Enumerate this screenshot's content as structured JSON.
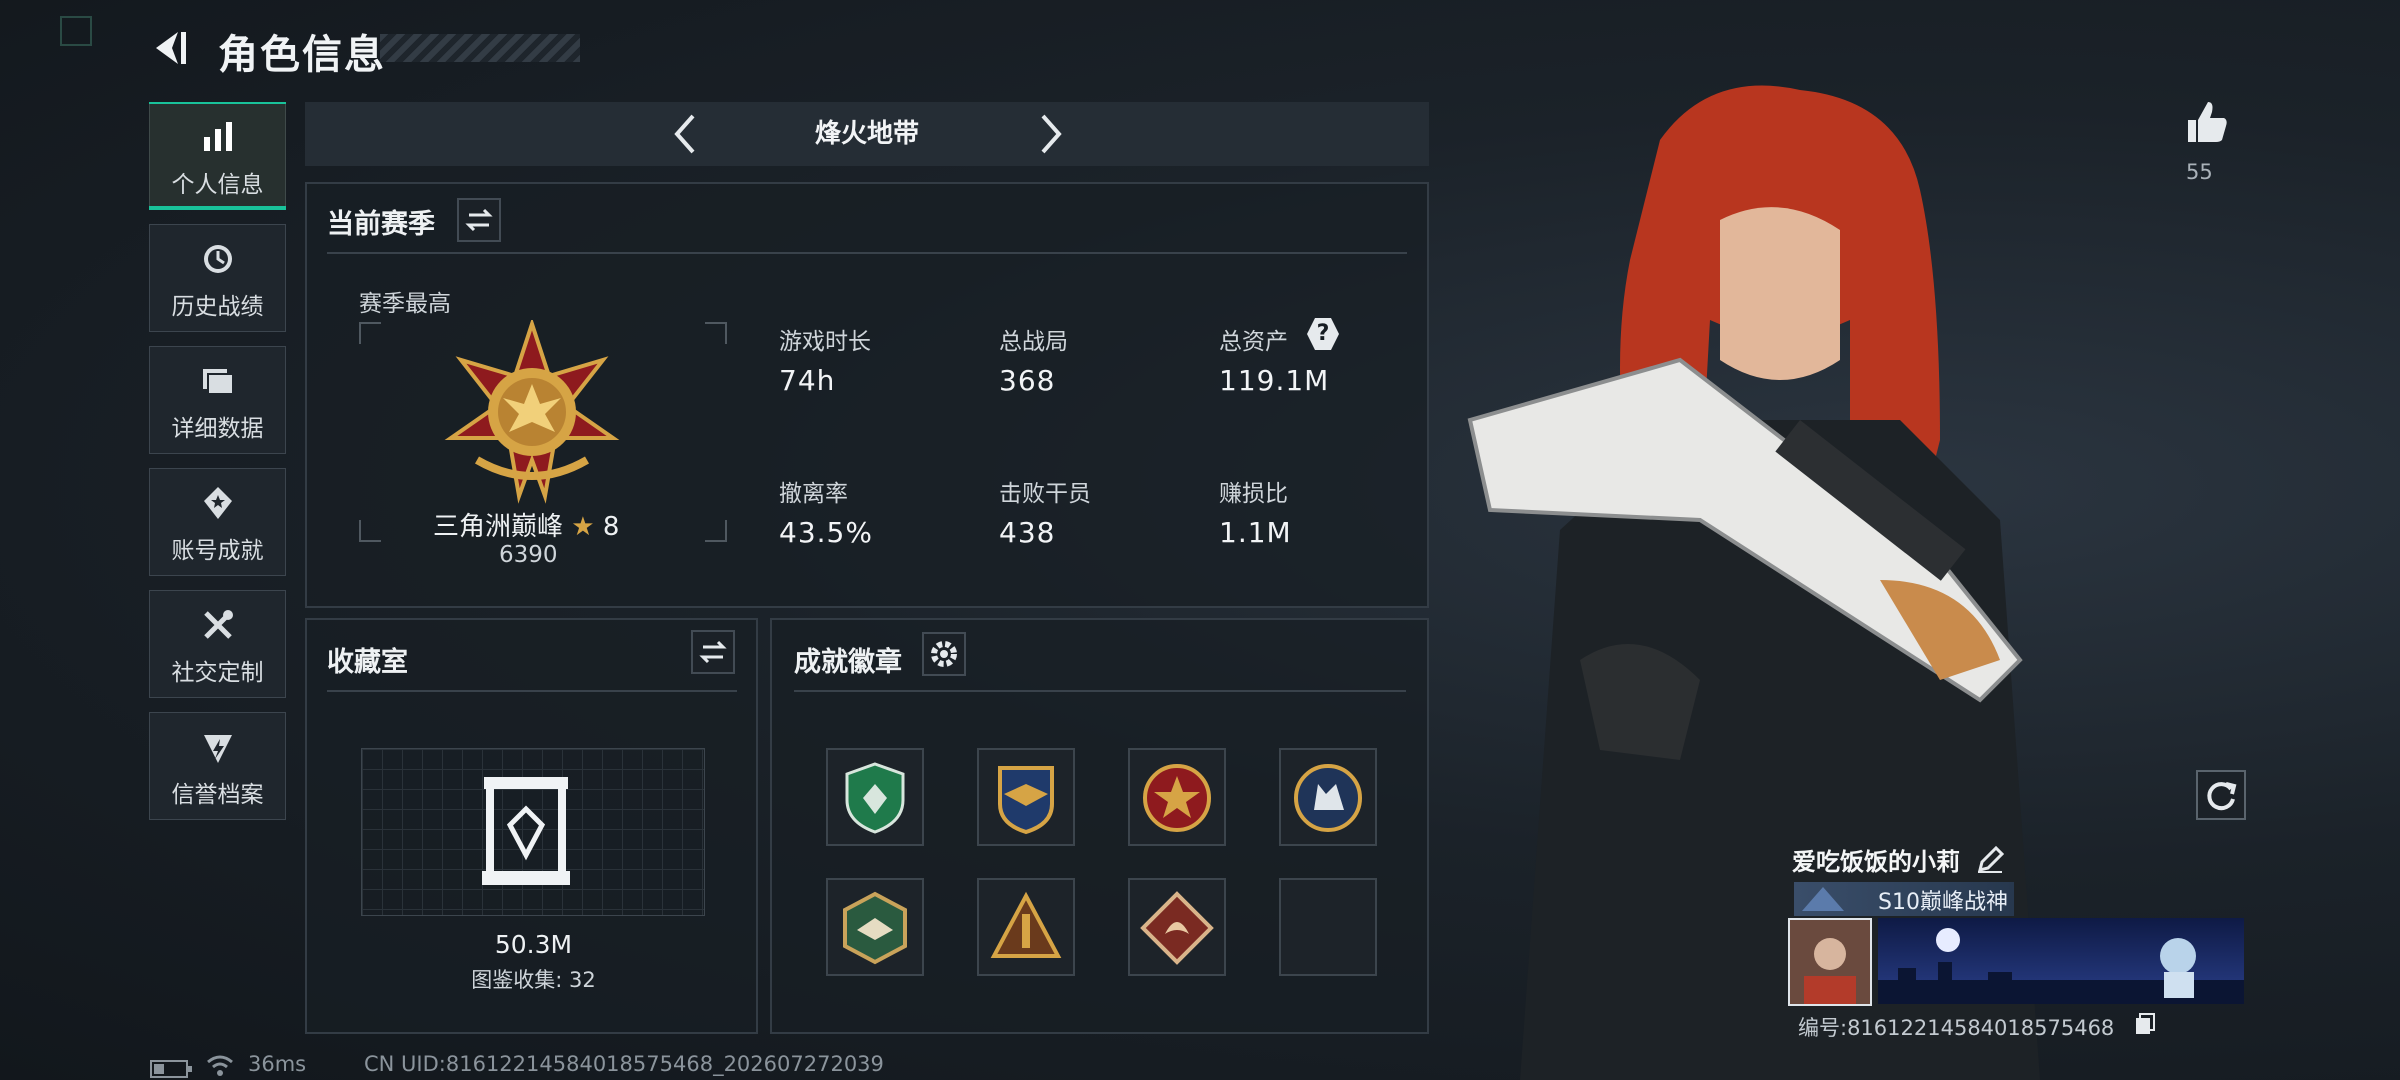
{
  "header": {
    "title": "角色信息"
  },
  "sidebar": {
    "items": [
      {
        "label": "个人信息",
        "icon": "bar-chart-icon",
        "active": true
      },
      {
        "label": "历史战绩",
        "icon": "history-icon"
      },
      {
        "label": "详细数据",
        "icon": "folder-icon"
      },
      {
        "label": "账号成就",
        "icon": "achievement-icon"
      },
      {
        "label": "社交定制",
        "icon": "tools-icon"
      },
      {
        "label": "信誉档案",
        "icon": "reputation-icon"
      }
    ]
  },
  "mode": {
    "name": "烽火地带"
  },
  "season": {
    "title": "当前赛季",
    "best_label": "赛季最高",
    "rank_name": "三角洲巅峰",
    "rank_stars": "8",
    "rank_points": "6390",
    "stats": [
      {
        "label": "游戏时长",
        "value": "74h"
      },
      {
        "label": "总战局",
        "value": "368"
      },
      {
        "label": "总资产",
        "value": "119.1M"
      },
      {
        "label": "撤离率",
        "value": "43.5%"
      },
      {
        "label": "击败干员",
        "value": "438"
      },
      {
        "label": "赚损比",
        "value": "1.1M"
      }
    ],
    "help_glyph": "?"
  },
  "collection": {
    "title": "收藏室",
    "value": "50.3M",
    "count_text": "图鉴收集: 32"
  },
  "badges": {
    "title": "成就徽章",
    "items": [
      "green-shield-badge-icon",
      "gold-wings-badge-icon",
      "red-star-badge-icon",
      "wolf-badge-icon",
      "hexagon-bird-badge-icon",
      "triangle-rocket-badge-icon",
      "dragon-diamond-badge-icon",
      "empty-badge-slot"
    ]
  },
  "profile": {
    "likes": "55",
    "player_name": "爱吃饭饭的小莉",
    "title_tag": "S10巅峰战神",
    "id_text": "编号:81612214584018575468"
  },
  "status": {
    "ping": "36ms",
    "uid": "CN UID:81612214584018575468_202607272039"
  },
  "colors": {
    "accent": "#19c29a",
    "hair": "#b8361f",
    "gold": "#d6a445"
  }
}
